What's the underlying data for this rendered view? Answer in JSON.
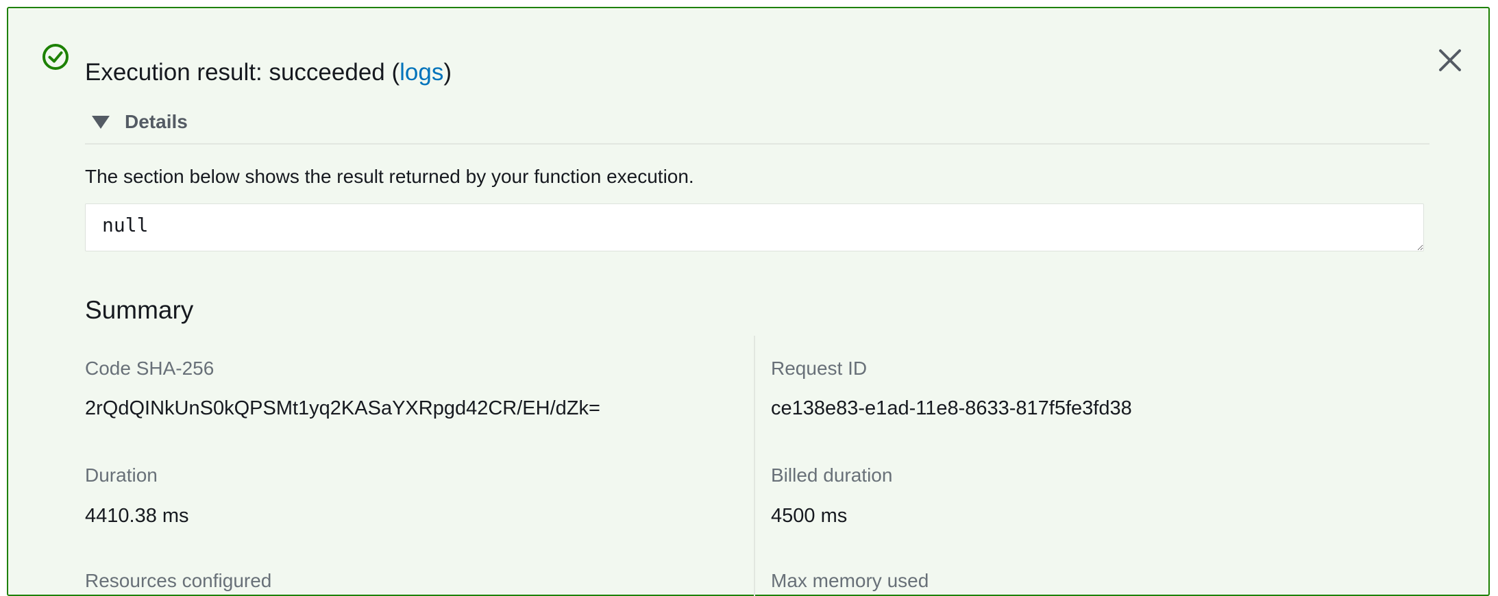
{
  "header": {
    "title_prefix": "Execution result: succeeded (",
    "logs_link": "logs",
    "title_suffix": ")",
    "status_color": "#1d8102"
  },
  "details": {
    "label": "Details",
    "description": "The section below shows the result returned by your function execution.",
    "result_value": "null"
  },
  "summary": {
    "heading": "Summary",
    "fields": {
      "code_sha_label": "Code SHA-256",
      "code_sha_value": "2rQdQINkUnS0kQPSMt1yq2KASaYXRpgd42CR/EH/dZk=",
      "request_id_label": "Request ID",
      "request_id_value": "ce138e83-e1ad-11e8-8633-817f5fe3fd38",
      "duration_label": "Duration",
      "duration_value": "4410.38 ms",
      "billed_duration_label": "Billed duration",
      "billed_duration_value": "4500 ms",
      "resources_label": "Resources configured",
      "max_memory_label": "Max memory used"
    }
  },
  "icons": {
    "status": "check-circle-icon",
    "close": "close-icon",
    "toggle": "caret-down-icon"
  }
}
